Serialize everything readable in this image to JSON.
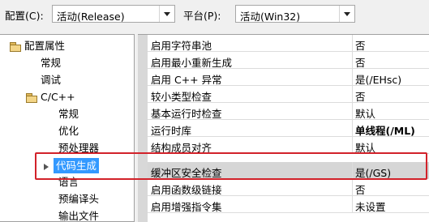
{
  "toolbar": {
    "config_label": "配置(C):",
    "config_value": "活动(Release)",
    "platform_label": "平台(P):",
    "platform_value": "活动(Win32)"
  },
  "tree": {
    "root": "配置属性",
    "items": [
      "常规",
      "调试",
      "C/C++",
      "常规",
      "优化",
      "预处理器",
      "代码生成",
      "语言",
      "预编译头",
      "输出文件"
    ],
    "selected": "代码生成"
  },
  "grid": {
    "rows": [
      {
        "name": "启用字符串池",
        "value": "否"
      },
      {
        "name": "启用最小重新生成",
        "value": "否"
      },
      {
        "name": "启用 C++ 异常",
        "value": "是(/EHsc)"
      },
      {
        "name": "较小类型检查",
        "value": "否"
      },
      {
        "name": "基本运行时检查",
        "value": "默认"
      },
      {
        "name": "运行时库",
        "value": "单线程(/ML)"
      },
      {
        "name": "结构成员对齐",
        "value": "默认"
      },
      {
        "name": "缓冲区安全检查",
        "value": "是(/GS)"
      },
      {
        "name": "启用函数级链接",
        "value": "否"
      },
      {
        "name": "启用增强指令集",
        "value": "未设置"
      }
    ]
  },
  "colors": {
    "selection": "#3399ff",
    "highlight_box": "#d2222a",
    "row_highlight": "#d6d6d6"
  }
}
